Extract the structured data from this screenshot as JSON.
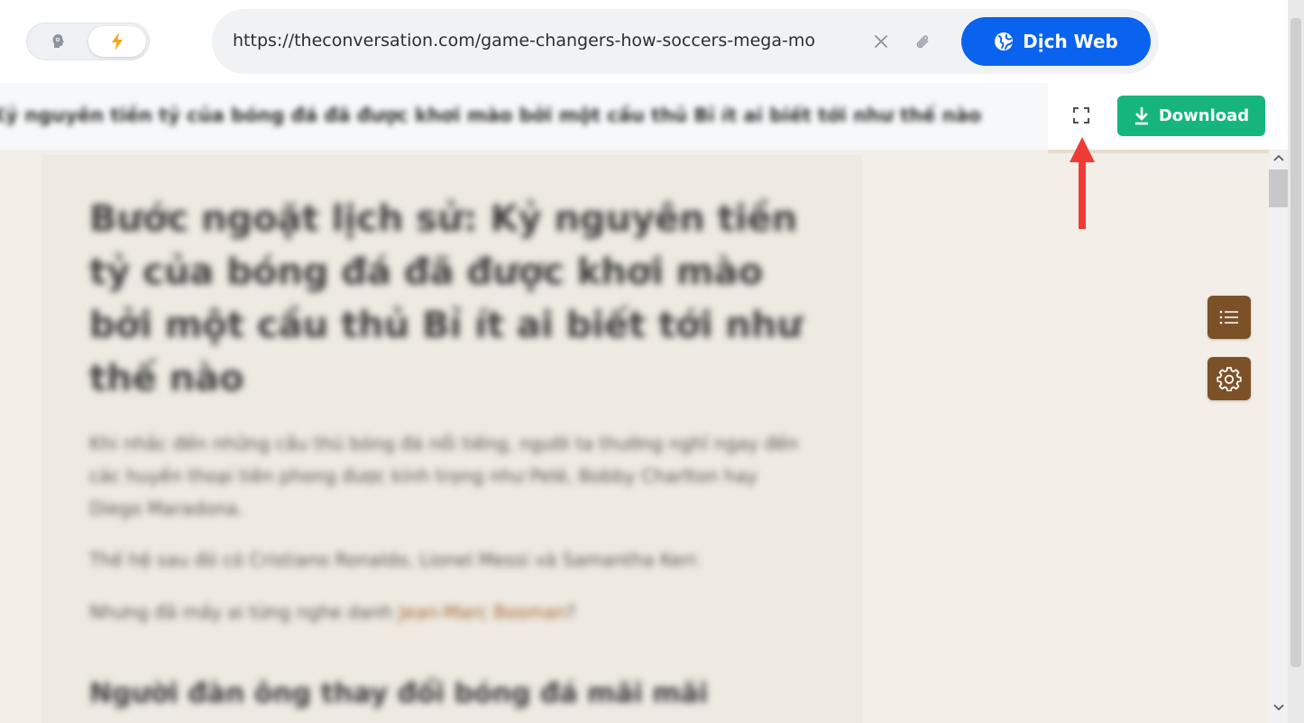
{
  "topbar": {
    "mode_toggle": {
      "options": [
        {
          "name": "brain",
          "active": false
        },
        {
          "name": "lightning",
          "active": true
        }
      ]
    },
    "url": "https://theconversation.com/game-changers-how-soccers-mega-mo",
    "translate_button_label": "Dịch Web"
  },
  "toolbar": {
    "article_title_blurred": "Kỷ nguyên tiền tỷ của bóng đá đã được khơi mào bởi một cầu thủ Bỉ ít ai biết tới như thế nào",
    "download_label": "Download"
  },
  "article": {
    "title": "Bước ngoặt lịch sử: Kỷ nguyên tiền tỷ của bóng đá đã được khơi mào bởi một cầu thủ Bỉ ít ai biết tới như thế nào",
    "paragraphs": [
      "Khi nhắc đến những cầu thủ bóng đá nổi tiếng, người ta thường nghĩ ngay đến các huyền thoại tiên phong được kính trọng như Pelé, Bobby Charlton hay Diego Maradona.",
      "Thế hệ sau đó có Cristiano Ronaldo, Lionel Messi và Samantha Kerr.",
      "Nhưng đã mấy ai từng nghe danh"
    ],
    "link_text": "Jean-Marc Bosman",
    "link_suffix": "?",
    "subheading": "Người đàn ông thay đổi bóng đá mãi mãi"
  },
  "colors": {
    "translate_button": "#0a63ef",
    "download_button": "#16b57c",
    "float_buttons": "#7c5128",
    "annotation_arrow": "#ef3b36",
    "content_background": "#f3efe8"
  },
  "icons": {
    "mode_brain": "brain-icon",
    "mode_lightning": "lightning-icon",
    "url_clear": "close-icon",
    "url_attach": "paperclip-icon",
    "translate": "globe-icon",
    "fullscreen": "fullscreen-icon",
    "download": "download-icon",
    "toc": "list-icon",
    "settings": "gear-icon"
  }
}
